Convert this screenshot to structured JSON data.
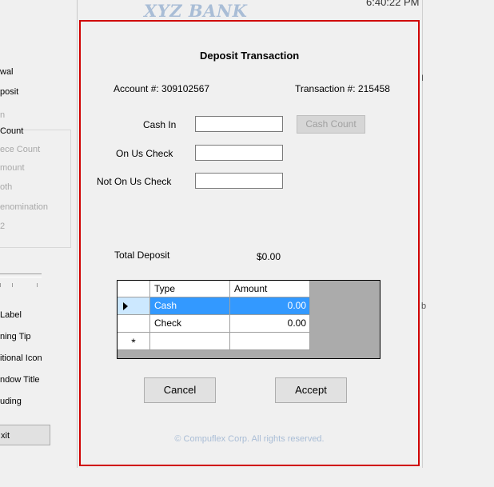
{
  "app": {
    "bank_name": "XYZ BANK",
    "clock": "6:40:22 PM"
  },
  "left_panel": {
    "items": [
      "wal",
      "posit",
      "n",
      "Count",
      "ece Count",
      "mount",
      "oth",
      "enomination",
      "2"
    ],
    "options": [
      "Label",
      "ning Tip",
      "itional Icon",
      "ndow Title",
      "uding"
    ],
    "exit_label": "xit"
  },
  "right_panel": {
    "glyphs": [
      "I",
      "b"
    ]
  },
  "dialog": {
    "title": "Deposit Transaction",
    "account_label": "Account #: 309102567",
    "transaction_label": "Transaction #:  215458",
    "cash_in_label": "Cash In",
    "cash_in_value": "",
    "cash_count_button": "Cash Count",
    "on_us_check_label": "On Us Check",
    "on_us_check_value": "",
    "not_on_us_check_label": "Not On Us Check",
    "not_on_us_check_value": "",
    "total_label": "Total Deposit",
    "total_value": "$0.00",
    "grid": {
      "columns": [
        "Type",
        "Amount"
      ],
      "rows": [
        {
          "type": "Cash",
          "amount": "0.00"
        },
        {
          "type": "Check",
          "amount": "0.00"
        }
      ],
      "new_row_marker": "*"
    },
    "cancel_label": "Cancel",
    "accept_label": "Accept",
    "copyright": "© Compuflex Corp. All rights reserved."
  },
  "colors": {
    "dialog_border": "#d00000",
    "selection": "#3399ff",
    "brand_text": "#a9bdd6"
  }
}
